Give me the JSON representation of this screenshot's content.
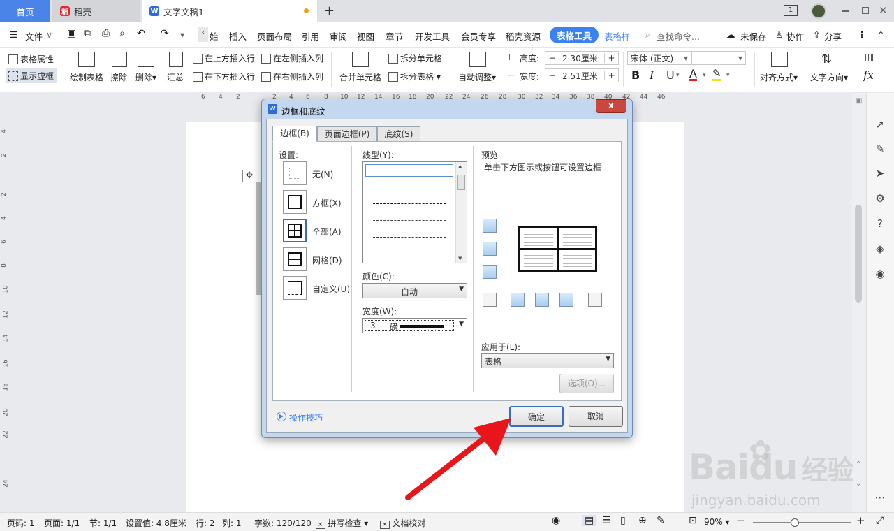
{
  "tabs": {
    "home": "首页",
    "daoke": "稻壳",
    "doc": "文字文稿1",
    "new_tab": "+"
  },
  "window": {
    "badge": "1"
  },
  "menu": {
    "file": "文件",
    "start": "始",
    "insert": "插入",
    "layout": "页面布局",
    "references": "引用",
    "review": "审阅",
    "view": "视图",
    "chapter": "章节",
    "dev": "开发工具",
    "vip": "会员专享",
    "resources": "稻壳资源",
    "table_tools": "表格工具",
    "table_style": "表格样",
    "search": "查找命令...",
    "unsaved": "未保存",
    "collab": "协作",
    "share": "分享"
  },
  "ribbon": {
    "table_props": "表格属性",
    "show_gridlines": "显示虚框",
    "draw_table": "绘制表格",
    "erase": "擦除",
    "delete": "删除",
    "summary": "汇总",
    "insert_above": "在上方插入行",
    "insert_below": "在下方插入行",
    "insert_left": "在左侧插入列",
    "insert_right": "在右侧插入列",
    "merge_cells": "合并单元格",
    "split_cells": "拆分单元格",
    "split_table": "拆分表格",
    "auto_adjust": "自动调整",
    "height_label": "高度:",
    "height_value": "2.30厘米",
    "width_label": "宽度:",
    "width_value": "2.51厘米",
    "font": "宋体 (正文)",
    "align": "对齐方式",
    "text_dir": "文字方向"
  },
  "ruler_h": [
    "6",
    "4",
    "2",
    "2",
    "4",
    "6",
    "8",
    "10",
    "12",
    "14",
    "16",
    "18",
    "20",
    "22",
    "24",
    "26",
    "28",
    "30",
    "32",
    "34",
    "36",
    "38",
    "40",
    "42",
    "44",
    "46"
  ],
  "ruler_v": [
    "4",
    "2",
    "2",
    "4",
    "6",
    "8",
    "10",
    "12",
    "14",
    "16",
    "18",
    "20",
    "22",
    "24"
  ],
  "dialog": {
    "title": "边框和底纹",
    "close": "x",
    "tabs": [
      "边框(B)",
      "页面边框(P)",
      "底纹(S)"
    ],
    "settings_label": "设置:",
    "settings": [
      "无(N)",
      "方框(X)",
      "全部(A)",
      "网格(D)",
      "自定义(U)"
    ],
    "line_style_label": "线型(Y):",
    "color_label": "颜色(C):",
    "color_value": "自动",
    "width_label": "宽度(W):",
    "width_value": "3",
    "width_unit": "磅",
    "preview_label": "预览",
    "preview_hint": "单击下方图示或按钮可设置边框",
    "apply_label": "应用于(L):",
    "apply_value": "表格",
    "options": "选项(O)...",
    "tips": "操作技巧",
    "ok": "确定",
    "cancel": "取消"
  },
  "status": {
    "page": "页码: 1",
    "pages": "页面: 1/1",
    "section": "节: 1/1",
    "setting": "设置值: 4.8厘米",
    "row": "行: 2",
    "col": "列: 1",
    "words": "字数: 120/120",
    "spell": "拼写检查",
    "proof": "文档校对",
    "zoom": "90%"
  },
  "watermark": {
    "brand": "Bai",
    "brand2": "du",
    "cn": "经验",
    "url": "jingyan.baidu.com"
  },
  "colors": {
    "accent": "#3b82f0",
    "home_tab": "#4a84e8",
    "arrow": "#e8151b"
  }
}
